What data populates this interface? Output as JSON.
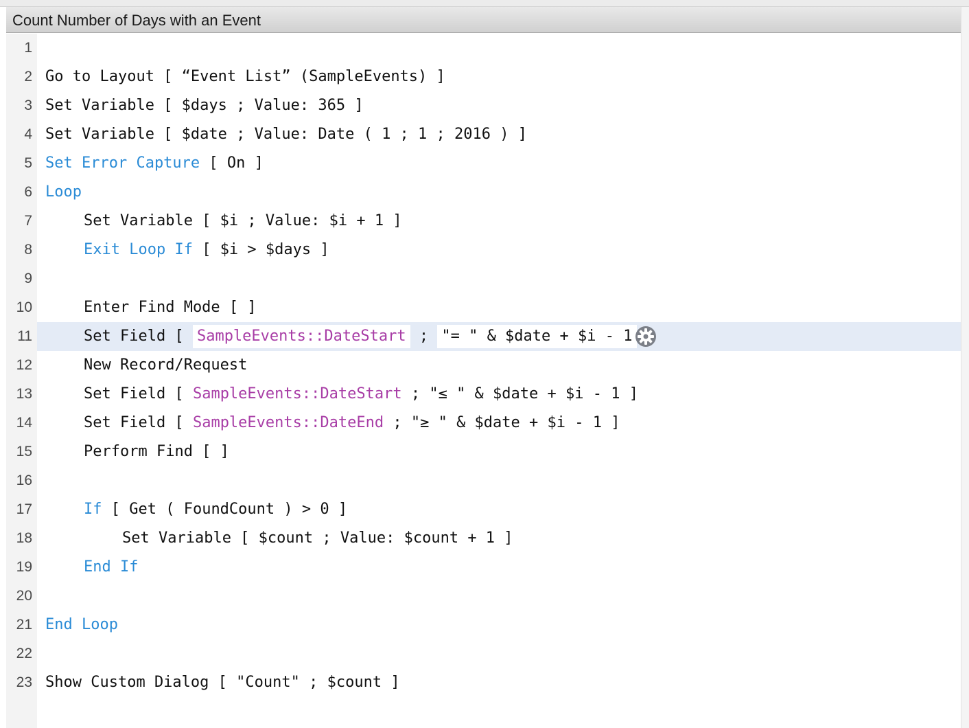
{
  "window": {
    "title": "Count Number of Days with an Event"
  },
  "colors": {
    "keyword": "#2a8bd6",
    "field": "#a83da6",
    "text": "#111111",
    "selected_line": "#e4ebf6"
  },
  "script": {
    "selected_line": 11,
    "lines": [
      {
        "num": "1"
      },
      {
        "num": "2",
        "indent": 0,
        "segments": [
          {
            "t": "Go to Layout [ “Event List” (SampleEvents) ]"
          }
        ]
      },
      {
        "num": "3",
        "indent": 0,
        "segments": [
          {
            "t": "Set Variable [ $days ; Value: 365 ]"
          }
        ]
      },
      {
        "num": "4",
        "indent": 0,
        "segments": [
          {
            "t": "Set Variable [ $date ; Value: Date ( 1 ; 1 ; 2016 ) ]"
          }
        ]
      },
      {
        "num": "5",
        "indent": 0,
        "segments": [
          {
            "t": "Set Error Capture",
            "k": "kw"
          },
          {
            "t": " [ On ]"
          }
        ]
      },
      {
        "num": "6",
        "indent": 0,
        "segments": [
          {
            "t": "Loop",
            "k": "kw"
          }
        ]
      },
      {
        "num": "7",
        "indent": 1,
        "segments": [
          {
            "t": "Set Variable [ $i ; Value: $i + 1 ]"
          }
        ]
      },
      {
        "num": "8",
        "indent": 1,
        "segments": [
          {
            "t": "Exit Loop If",
            "k": "kw"
          },
          {
            "t": " [ $i > $days ]"
          }
        ]
      },
      {
        "num": "9"
      },
      {
        "num": "10",
        "indent": 1,
        "segments": [
          {
            "t": "Enter Find Mode [ ]"
          }
        ]
      },
      {
        "num": "11",
        "indent": 1,
        "segments": [
          {
            "t": "Set Field [ "
          },
          {
            "t": "SampleEvents::DateStart",
            "k": "fld",
            "box": true
          },
          {
            "t": " ; "
          },
          {
            "t": "\"= \" & $date + $i - 1",
            "box": true
          },
          {
            "t": " ]"
          }
        ]
      },
      {
        "num": "12",
        "indent": 1,
        "segments": [
          {
            "t": "New Record/Request"
          }
        ]
      },
      {
        "num": "13",
        "indent": 1,
        "segments": [
          {
            "t": "Set Field [ "
          },
          {
            "t": "SampleEvents::DateStart",
            "k": "fld"
          },
          {
            "t": " ; \"≤ \" & $date + $i - 1 ]"
          }
        ]
      },
      {
        "num": "14",
        "indent": 1,
        "segments": [
          {
            "t": "Set Field [ "
          },
          {
            "t": "SampleEvents::DateEnd",
            "k": "fld"
          },
          {
            "t": " ; \"≥ \" & $date + $i - 1 ]"
          }
        ]
      },
      {
        "num": "15",
        "indent": 1,
        "segments": [
          {
            "t": "Perform Find [ ]"
          }
        ]
      },
      {
        "num": "16"
      },
      {
        "num": "17",
        "indent": 1,
        "segments": [
          {
            "t": "If",
            "k": "kw"
          },
          {
            "t": " [ Get ( FoundCount ) > 0 ]"
          }
        ]
      },
      {
        "num": "18",
        "indent": 2,
        "segments": [
          {
            "t": "Set Variable [ $count ; Value: $count + 1 ]"
          }
        ]
      },
      {
        "num": "19",
        "indent": 1,
        "segments": [
          {
            "t": "End If",
            "k": "kw"
          }
        ]
      },
      {
        "num": "20"
      },
      {
        "num": "21",
        "indent": 0,
        "segments": [
          {
            "t": "End Loop",
            "k": "kw"
          }
        ]
      },
      {
        "num": "22"
      },
      {
        "num": "23",
        "indent": 0,
        "segments": [
          {
            "t": "Show Custom Dialog [ \"Count\" ; $count ]"
          }
        ]
      }
    ],
    "options_icon": "gear-icon"
  }
}
